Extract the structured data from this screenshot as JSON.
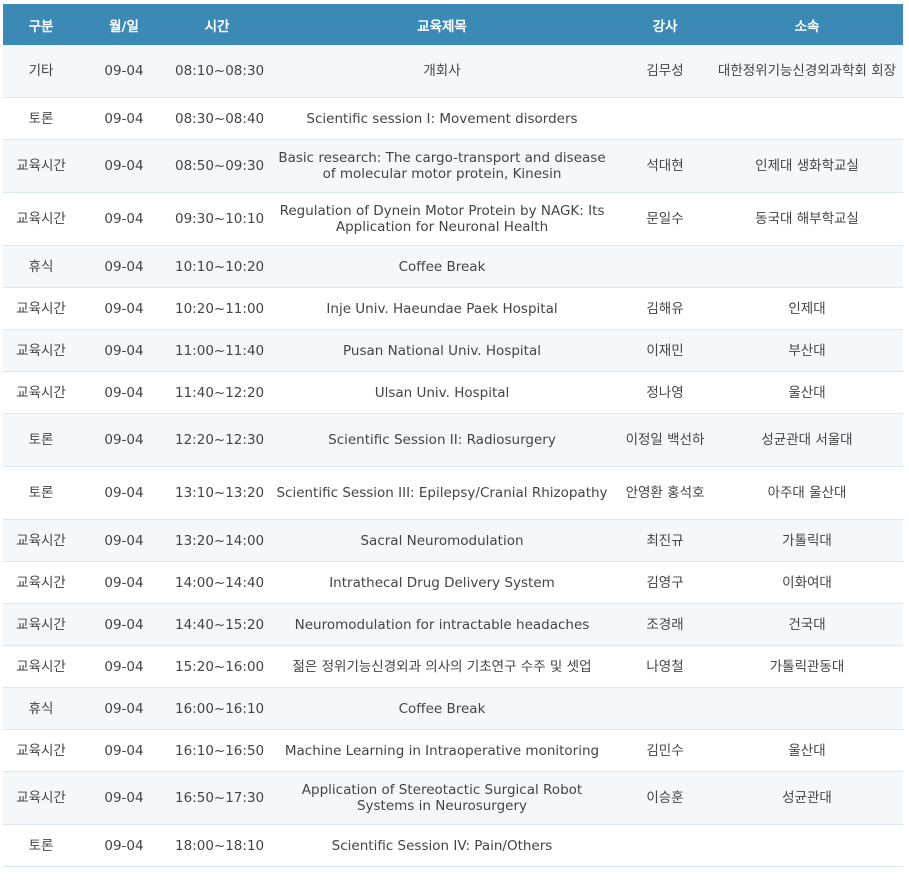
{
  "columns": [
    "구분",
    "월/일",
    "시간",
    "교육제목",
    "강사",
    "소속"
  ],
  "rows": [
    {
      "type": "기타",
      "date": "09-04",
      "time": "08:10~08:30",
      "title": "개회사",
      "speaker": "김무성",
      "affiliation": "대한정위기능신경외과학회 회장",
      "h": "h52"
    },
    {
      "type": "토론",
      "date": "09-04",
      "time": "08:30~08:40",
      "title": "Scientific session I: Movement disorders",
      "speaker": "",
      "affiliation": "",
      "h": "h42"
    },
    {
      "type": "교육시간",
      "date": "09-04",
      "time": "08:50~09:30",
      "title": "Basic research: The cargo-transport and disease of molecular motor protein, Kinesin",
      "speaker": "석대현",
      "affiliation": "인제대 생화학교실",
      "h": "h53"
    },
    {
      "type": "교육시간",
      "date": "09-04",
      "time": "09:30~10:10",
      "title": "Regulation of Dynein Motor Protein by NAGK: Its Application for Neuronal Health",
      "speaker": "문일수",
      "affiliation": "동국대 해부학교실",
      "h": "h53"
    },
    {
      "type": "휴식",
      "date": "09-04",
      "time": "10:10~10:20",
      "title": "Coffee Break",
      "speaker": "",
      "affiliation": "",
      "h": "h42"
    },
    {
      "type": "교육시간",
      "date": "09-04",
      "time": "10:20~11:00",
      "title": "Inje Univ. Haeundae Paek Hospital",
      "speaker": "김해유",
      "affiliation": "인제대",
      "h": "h42"
    },
    {
      "type": "교육시간",
      "date": "09-04",
      "time": "11:00~11:40",
      "title": "Pusan National Univ. Hospital",
      "speaker": "이재민",
      "affiliation": "부산대",
      "h": "h42"
    },
    {
      "type": "교육시간",
      "date": "09-04",
      "time": "11:40~12:20",
      "title": "Ulsan Univ. Hospital",
      "speaker": "정나영",
      "affiliation": "울산대",
      "h": "h42"
    },
    {
      "type": "토론",
      "date": "09-04",
      "time": "12:20~12:30",
      "title": "Scientific Session II: Radiosurgery",
      "speaker": "이정일 백선하",
      "affiliation": "성균관대 서울대",
      "h": "h53"
    },
    {
      "type": "토론",
      "date": "09-04",
      "time": "13:10~13:20",
      "title": "Scientific Session III: Epilepsy/Cranial Rhizopathy",
      "speaker": "안영환 홍석호",
      "affiliation": "아주대 울산대",
      "h": "h53"
    },
    {
      "type": "교육시간",
      "date": "09-04",
      "time": "13:20~14:00",
      "title": "Sacral Neuromodulation",
      "speaker": "최진규",
      "affiliation": "가톨릭대",
      "h": "h42"
    },
    {
      "type": "교육시간",
      "date": "09-04",
      "time": "14:00~14:40",
      "title": "Intrathecal Drug Delivery System",
      "speaker": "김영구",
      "affiliation": "이화여대",
      "h": "h42"
    },
    {
      "type": "교육시간",
      "date": "09-04",
      "time": "14:40~15:20",
      "title": "Neuromodulation for intractable headaches",
      "speaker": "조경래",
      "affiliation": "건국대",
      "h": "h42"
    },
    {
      "type": "교육시간",
      "date": "09-04",
      "time": "15:20~16:00",
      "title": "젊은 정위기능신경외과 의사의 기초연구 수주 및 셋업",
      "speaker": "나영철",
      "affiliation": "가톨릭관동대",
      "h": "h42"
    },
    {
      "type": "휴식",
      "date": "09-04",
      "time": "16:00~16:10",
      "title": "Coffee Break",
      "speaker": "",
      "affiliation": "",
      "h": "h42"
    },
    {
      "type": "교육시간",
      "date": "09-04",
      "time": "16:10~16:50",
      "title": "Machine Learning in Intraoperative monitoring",
      "speaker": "김민수",
      "affiliation": "울산대",
      "h": "h42"
    },
    {
      "type": "교육시간",
      "date": "09-04",
      "time": "16:50~17:30",
      "title": "Application of Stereotactic Surgical Robot Systems in Neurosurgery",
      "speaker": "이승훈",
      "affiliation": "성균관대",
      "h": "h53"
    },
    {
      "type": "토론",
      "date": "09-04",
      "time": "18:00~18:10",
      "title": "Scientific Session IV: Pain/Others",
      "speaker": "",
      "affiliation": "",
      "h": "h42"
    }
  ]
}
